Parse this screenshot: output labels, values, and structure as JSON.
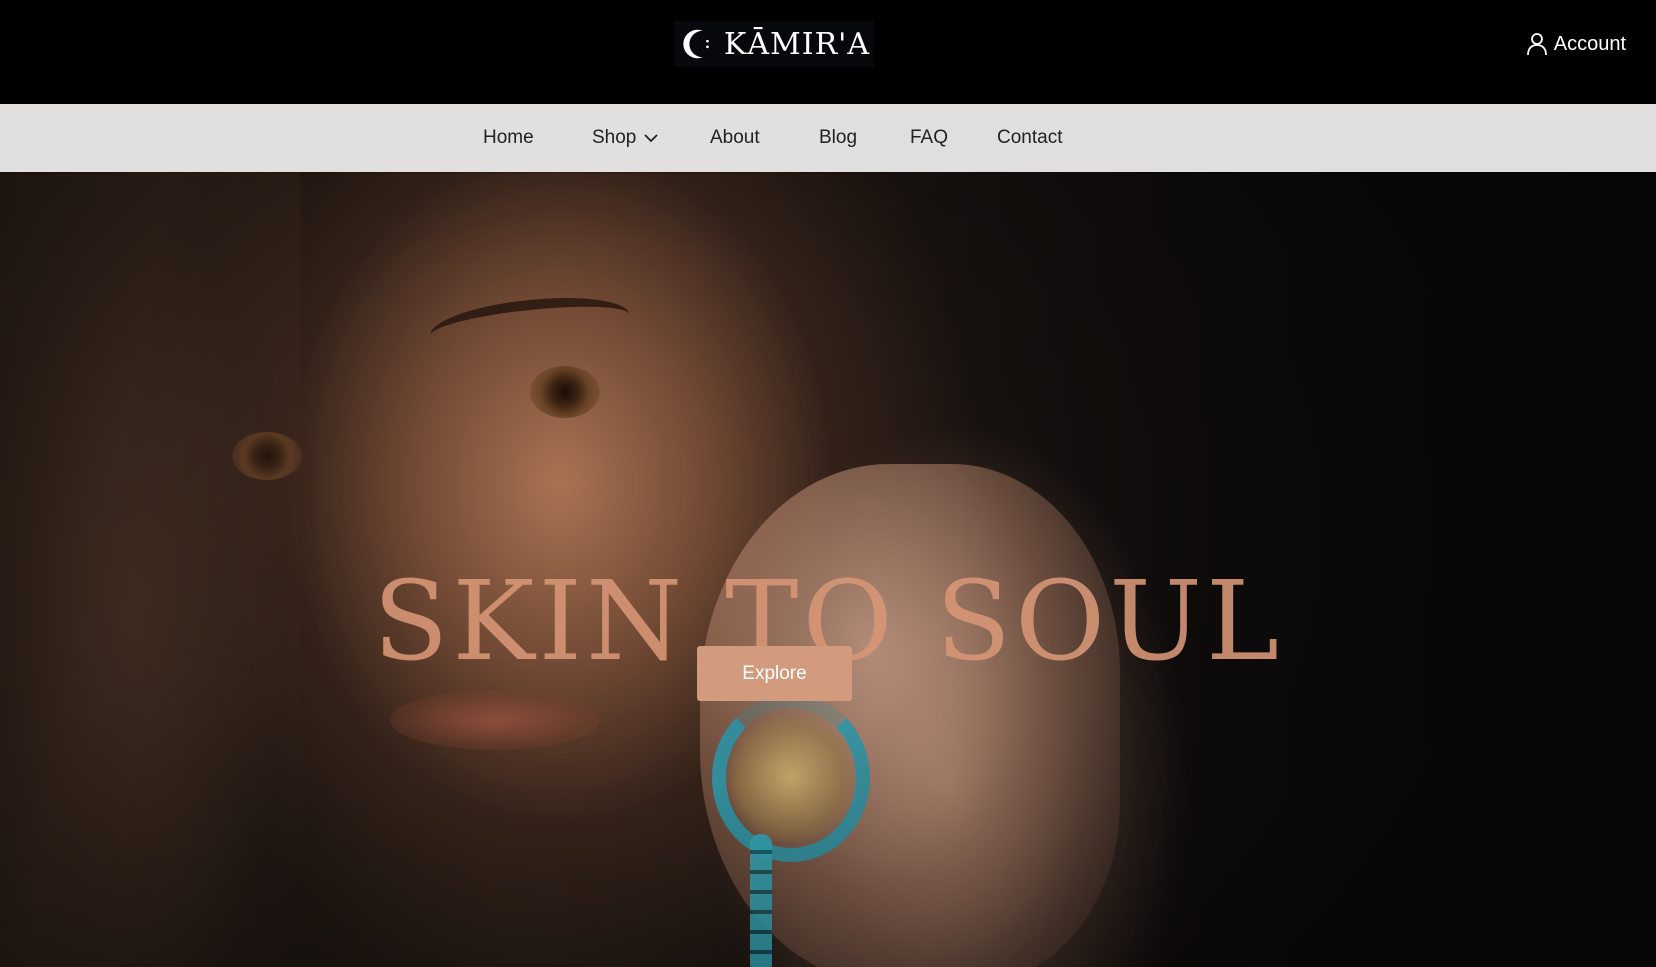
{
  "header": {
    "logo_text": "KĀMIR'A",
    "account_label": "Account"
  },
  "nav": {
    "items": [
      {
        "label": "Home"
      },
      {
        "label": "Shop",
        "has_dropdown": true
      },
      {
        "label": "About"
      },
      {
        "label": "Blog"
      },
      {
        "label": "FAQ"
      },
      {
        "label": "Contact"
      }
    ]
  },
  "hero": {
    "title": "SKIN TO SOUL",
    "cta_label": "Explore"
  },
  "colors": {
    "topbar": "#000000",
    "navbar": "#ecebea",
    "accent": "#d39b7e",
    "title": "#d6967680"
  },
  "icons": {
    "account": "user-icon",
    "shop_dropdown": "chevron-down-icon",
    "logo_mark": "crescent-moon-icon"
  }
}
